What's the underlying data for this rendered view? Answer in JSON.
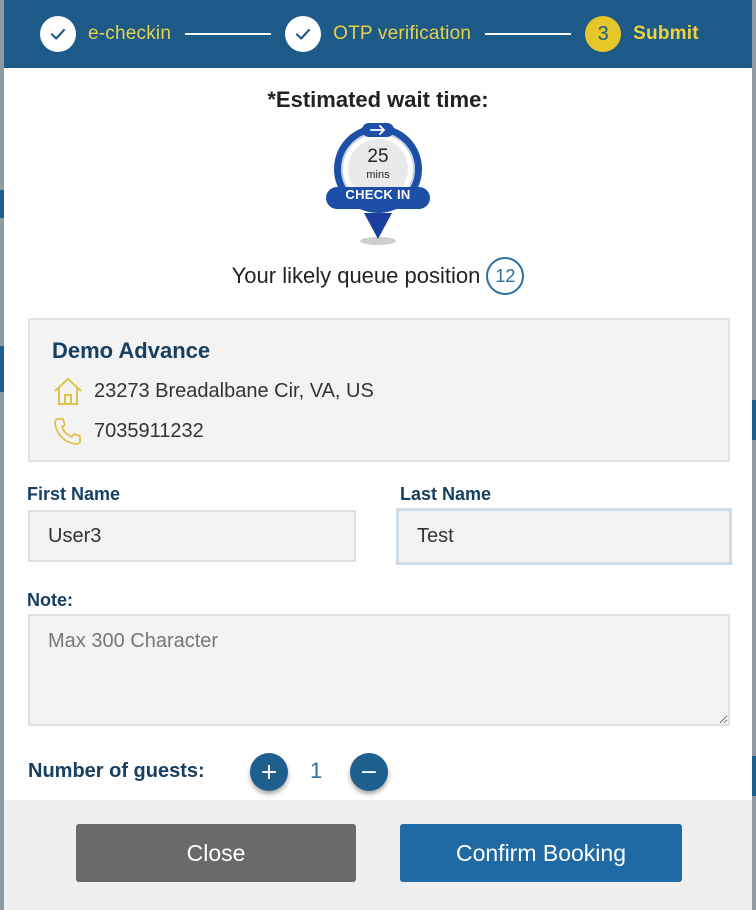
{
  "stepper": {
    "steps": [
      {
        "label": "e-checkin",
        "state": "done"
      },
      {
        "label": "OTP verification",
        "state": "done"
      },
      {
        "label": "Submit",
        "number": "3",
        "state": "active"
      }
    ]
  },
  "wait": {
    "title": "*Estimated wait time:",
    "minutes": "25",
    "unit": "mins",
    "badge": "CHECK IN"
  },
  "queue": {
    "label": "Your likely queue position",
    "position": "12"
  },
  "business": {
    "name": "Demo Advance",
    "address": "23273 Breadalbane Cir, VA, US",
    "phone": "7035911232",
    "icons": {
      "address": "home-icon",
      "phone": "phone-icon"
    }
  },
  "form": {
    "first_name": {
      "label": "First Name",
      "value": "User3"
    },
    "last_name": {
      "label": "Last Name",
      "value": "Test"
    },
    "note": {
      "label": "Note:",
      "placeholder": "Max 300 Character",
      "value": ""
    },
    "guests": {
      "label": "Number of guests:",
      "count": "1",
      "plus": "+",
      "minus": "−"
    }
  },
  "footer": {
    "close_label": "Close",
    "confirm_label": "Confirm Booking"
  },
  "colors": {
    "header": "#1e5a87",
    "accent": "#e6c72a",
    "primary_button": "#1f6aa5",
    "secondary_button": "#6a6a6a"
  }
}
